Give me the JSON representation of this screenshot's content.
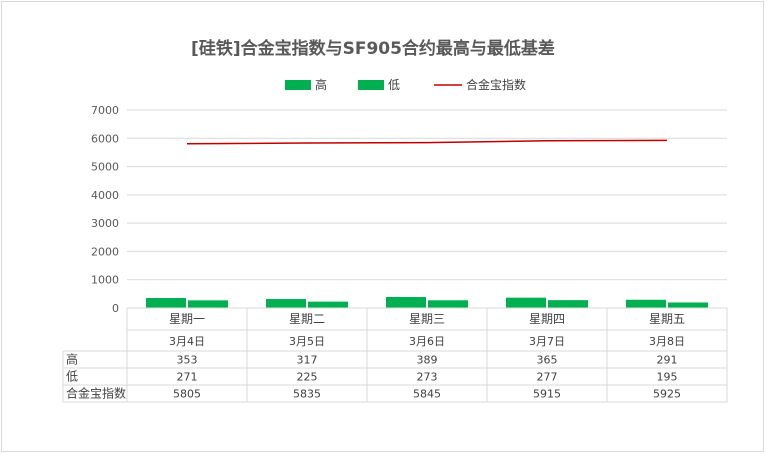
{
  "chart_data": {
    "type": "bar",
    "title": "[硅铁]合金宝指数与SF905合约最高与最低基差",
    "categories": [
      "星期一",
      "星期二",
      "星期三",
      "星期四",
      "星期五"
    ],
    "dates": [
      "3月4日",
      "3月5日",
      "3月6日",
      "3月7日",
      "3月8日"
    ],
    "series": [
      {
        "name": "高",
        "type": "bar",
        "color": "#00b050",
        "values": [
          353,
          317,
          389,
          365,
          291
        ]
      },
      {
        "name": "低",
        "type": "bar",
        "color": "#00b050",
        "values": [
          271,
          225,
          273,
          277,
          195
        ]
      },
      {
        "name": "合金宝指数",
        "type": "line",
        "color": "#c00000",
        "values": [
          5805,
          5835,
          5845,
          5915,
          5925
        ]
      }
    ],
    "ylim": [
      0,
      7000
    ],
    "yticks": [
      0,
      1000,
      2000,
      3000,
      4000,
      5000,
      6000,
      7000
    ],
    "grid": true,
    "legend_position": "top",
    "data_table": true
  }
}
